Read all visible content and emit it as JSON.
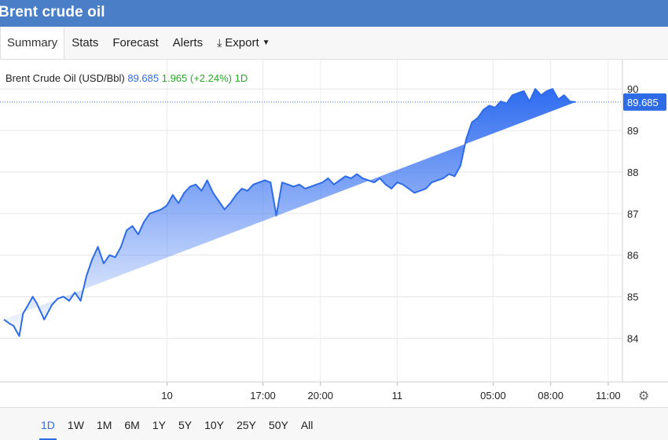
{
  "app": {
    "title": "Brent crude oil"
  },
  "tabs": [
    {
      "label": "Summary"
    },
    {
      "label": "Stats"
    },
    {
      "label": "Forecast"
    },
    {
      "label": "Alerts"
    },
    {
      "label": "Export"
    }
  ],
  "legend": {
    "name": "Brent Crude Oil (USD/Bbl)",
    "price": "89.685",
    "change": "1.965 (+2.24%) 1D"
  },
  "current_price_label": "89.685",
  "ranges": [
    "1D",
    "1W",
    "1M",
    "6M",
    "1Y",
    "5Y",
    "10Y",
    "25Y",
    "50Y",
    "All"
  ],
  "colors": {
    "accent": "#2e6be6",
    "positive": "#29a829",
    "title_bg": "#4a7fc8"
  },
  "icons": {
    "export": "download-icon",
    "settings": "gear-icon"
  },
  "chart_data": {
    "type": "area",
    "x_tick_labels": [
      "10",
      "17:00",
      "20:00",
      "11",
      "05:00",
      "08:00",
      "11:00"
    ],
    "x_ticks_hours": [
      0,
      5,
      8,
      12,
      17,
      20,
      23
    ],
    "x_range_hours": [
      -8.5,
      23.25
    ],
    "y_ticks": [
      84,
      85,
      86,
      87,
      88,
      89,
      90
    ],
    "ylim": [
      82.95,
      90.25
    ],
    "current_price": 89.685,
    "x_hours": [
      -8.5,
      -8.2,
      -8.0,
      -7.7,
      -7.5,
      -7.3,
      -7.0,
      -6.8,
      -6.6,
      -6.4,
      -6.0,
      -5.7,
      -5.4,
      -5.1,
      -4.8,
      -4.5,
      -4.2,
      -3.9,
      -3.6,
      -3.3,
      -3.0,
      -2.7,
      -2.4,
      -2.1,
      -1.8,
      -1.5,
      -1.2,
      -0.9,
      -0.6,
      -0.3,
      0.0,
      0.3,
      0.6,
      0.9,
      1.2,
      1.5,
      1.8,
      2.1,
      2.4,
      2.7,
      3.0,
      3.3,
      3.6,
      3.9,
      4.2,
      4.5,
      4.8,
      5.1,
      5.4,
      5.7,
      6.0,
      6.3,
      6.6,
      6.9,
      7.2,
      7.5,
      7.8,
      8.1,
      8.4,
      8.7,
      9.0,
      9.3,
      9.6,
      9.9,
      10.2,
      10.5,
      10.8,
      11.1,
      11.4,
      11.7,
      12.0,
      12.3,
      12.6,
      12.9,
      13.2,
      13.5,
      13.8,
      14.1,
      14.4,
      14.7,
      15.0,
      15.3,
      15.6,
      15.9,
      16.2,
      16.5,
      16.8,
      17.1,
      17.4,
      17.7,
      18.0,
      18.3,
      18.6,
      18.9,
      19.2,
      19.5,
      19.8,
      20.1,
      20.4,
      20.7,
      21.0,
      21.3,
      21.6,
      21.9,
      22.2,
      22.5,
      22.8,
      23.1
    ],
    "y_values": [
      84.45,
      84.35,
      84.3,
      84.05,
      84.6,
      84.75,
      85.0,
      84.85,
      84.65,
      84.45,
      84.8,
      84.95,
      85.0,
      84.9,
      85.1,
      84.9,
      85.5,
      85.9,
      86.2,
      85.8,
      86.0,
      85.95,
      86.2,
      86.6,
      86.7,
      86.5,
      86.8,
      87.0,
      87.05,
      87.1,
      87.2,
      87.45,
      87.25,
      87.5,
      87.65,
      87.7,
      87.55,
      87.8,
      87.5,
      87.3,
      87.1,
      87.25,
      87.45,
      87.6,
      87.55,
      87.7,
      87.75,
      87.8,
      87.75,
      86.95,
      87.75,
      87.7,
      87.65,
      87.7,
      87.6,
      87.65,
      87.7,
      87.75,
      87.85,
      87.7,
      87.8,
      87.9,
      87.85,
      87.95,
      87.85,
      87.8,
      87.75,
      87.85,
      87.7,
      87.6,
      87.75,
      87.7,
      87.6,
      87.5,
      87.55,
      87.6,
      87.75,
      87.8,
      87.85,
      87.95,
      87.9,
      88.15,
      88.8,
      89.2,
      89.3,
      89.5,
      89.6,
      89.55,
      89.7,
      89.65,
      89.85,
      89.9,
      89.95,
      89.7,
      90.0,
      89.85,
      89.95,
      90.0,
      89.75,
      89.85,
      89.7,
      89.685
    ]
  }
}
